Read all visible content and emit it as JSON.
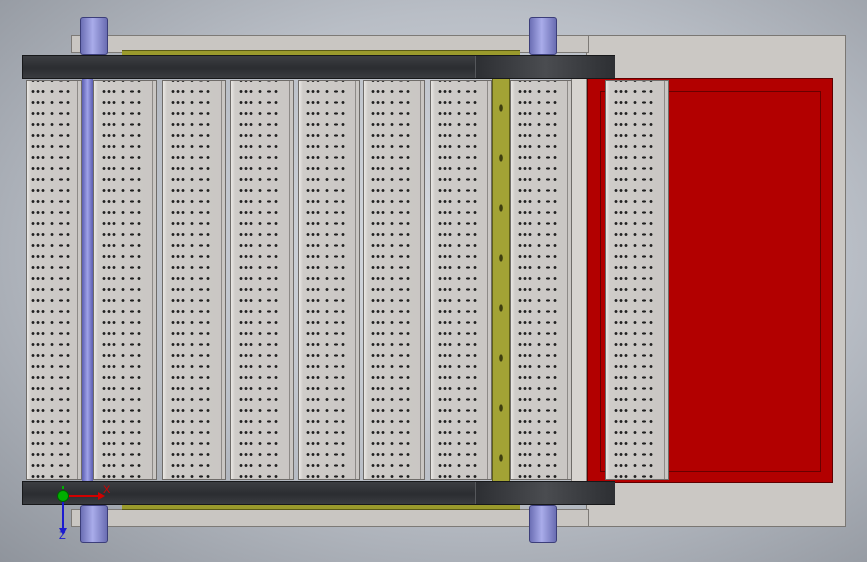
{
  "viewport": {
    "background": "gradient-grey",
    "model": {
      "module_count": 9,
      "colors": {
        "frame": "#c9c6c2",
        "olive_rail": "#9a9a2c",
        "dark_beam": "#2f3135",
        "red_panel": "#b20000",
        "pin": "#8e91d8",
        "module": "#c9c6c3"
      }
    }
  },
  "triad": {
    "x_label": "X",
    "z_label": "Z",
    "x_color": "#d10000",
    "y_color": "#00b000",
    "z_color": "#1b1bd0"
  }
}
